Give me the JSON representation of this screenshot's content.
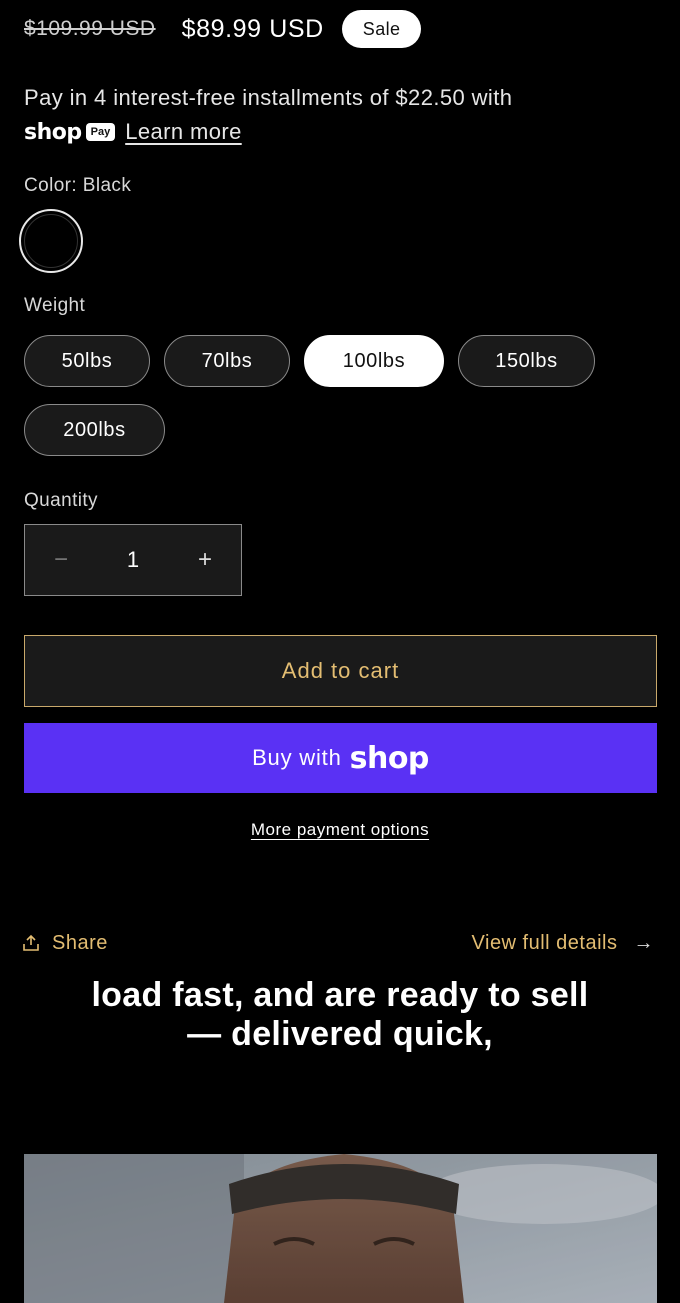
{
  "price": {
    "original": "$109.99 USD",
    "sale": "$89.99 USD",
    "badge": "Sale"
  },
  "installments": {
    "text": "Pay in 4 interest-free installments of $22.50 with",
    "shop_logo": "shop",
    "pay_badge": "Pay",
    "learn_more": "Learn more"
  },
  "color": {
    "label": "Color: Black",
    "swatch": "#000000"
  },
  "weight": {
    "label": "Weight",
    "options": [
      "50lbs",
      "70lbs",
      "100lbs",
      "150lbs",
      "200lbs"
    ],
    "selected": "100lbs"
  },
  "quantity": {
    "label": "Quantity",
    "minus": "−",
    "value": "1",
    "plus": "+"
  },
  "buttons": {
    "add_to_cart": "Add to cart",
    "buy_with": "Buy with",
    "buy_logo": "shop",
    "more_payment": "More payment options"
  },
  "links": {
    "share": "Share",
    "view_details": "View full details",
    "arrow": "→"
  },
  "caption": {
    "line1": "load fast, and are ready to sell",
    "line2": "— delivered quick,"
  },
  "colors": {
    "accent_gold": "#e3bd72",
    "shop_purple": "#5a31f4",
    "background": "#000000"
  }
}
